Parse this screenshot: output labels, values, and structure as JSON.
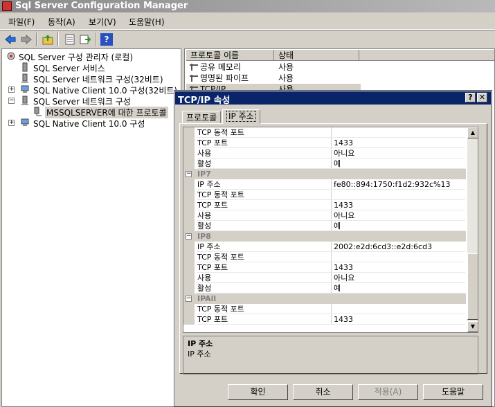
{
  "window": {
    "title": "Sql Server Configuration Manager"
  },
  "menu": [
    "파일(F)",
    "동작(A)",
    "보기(V)",
    "도움말(H)"
  ],
  "tree": {
    "root": "SQL Server 구성 관리자 (로컬)",
    "items": [
      "SQL Server 서비스",
      "SQL Server 네트워크 구성(32비트)",
      "SQL Native Client 10.0 구성(32비트)",
      "SQL Server 네트워크 구성",
      "MSSQLSERVER에 대한 프로토콜",
      "SQL Native Client 10.0 구성"
    ]
  },
  "list": {
    "headers": [
      "프로토콜 이름",
      "상태"
    ],
    "rows": [
      {
        "name": "공유 메모리",
        "status": "사용"
      },
      {
        "name": "명명된 파이프",
        "status": "사용"
      },
      {
        "name": "TCP/IP",
        "status": "사용"
      }
    ]
  },
  "dialog": {
    "title": "TCP/IP 속성",
    "help_btn": "?",
    "close_btn": "✕",
    "tabs": [
      "프로토콜",
      "IP 주소"
    ],
    "top_rows": [
      {
        "name": "TCP 동적 포트",
        "value": ""
      },
      {
        "name": "TCP 포트",
        "value": "1433"
      },
      {
        "name": "사용",
        "value": "아니요"
      },
      {
        "name": "활성",
        "value": "예"
      }
    ],
    "groups": [
      {
        "title": "IP7",
        "rows": [
          {
            "name": "IP 주소",
            "value": "fe80::894:1750:f1d2:932c%13"
          },
          {
            "name": "TCP 동적 포트",
            "value": ""
          },
          {
            "name": "TCP 포트",
            "value": "1433"
          },
          {
            "name": "사용",
            "value": "아니요"
          },
          {
            "name": "활성",
            "value": "예"
          }
        ]
      },
      {
        "title": "IP8",
        "rows": [
          {
            "name": "IP 주소",
            "value": "2002:e2d:6cd3::e2d:6cd3"
          },
          {
            "name": "TCP 동적 포트",
            "value": ""
          },
          {
            "name": "TCP 포트",
            "value": "1433"
          },
          {
            "name": "사용",
            "value": "아니요"
          },
          {
            "name": "활성",
            "value": "예"
          }
        ]
      },
      {
        "title": "IPAll",
        "rows": [
          {
            "name": "TCP 동적 포트",
            "value": ""
          },
          {
            "name": "TCP 포트",
            "value": "1433"
          }
        ]
      }
    ],
    "description": {
      "title": "IP 주소",
      "text": "IP 주소"
    },
    "buttons": {
      "ok": "확인",
      "cancel": "취소",
      "apply": "적용(A)",
      "help": "도움말"
    }
  }
}
